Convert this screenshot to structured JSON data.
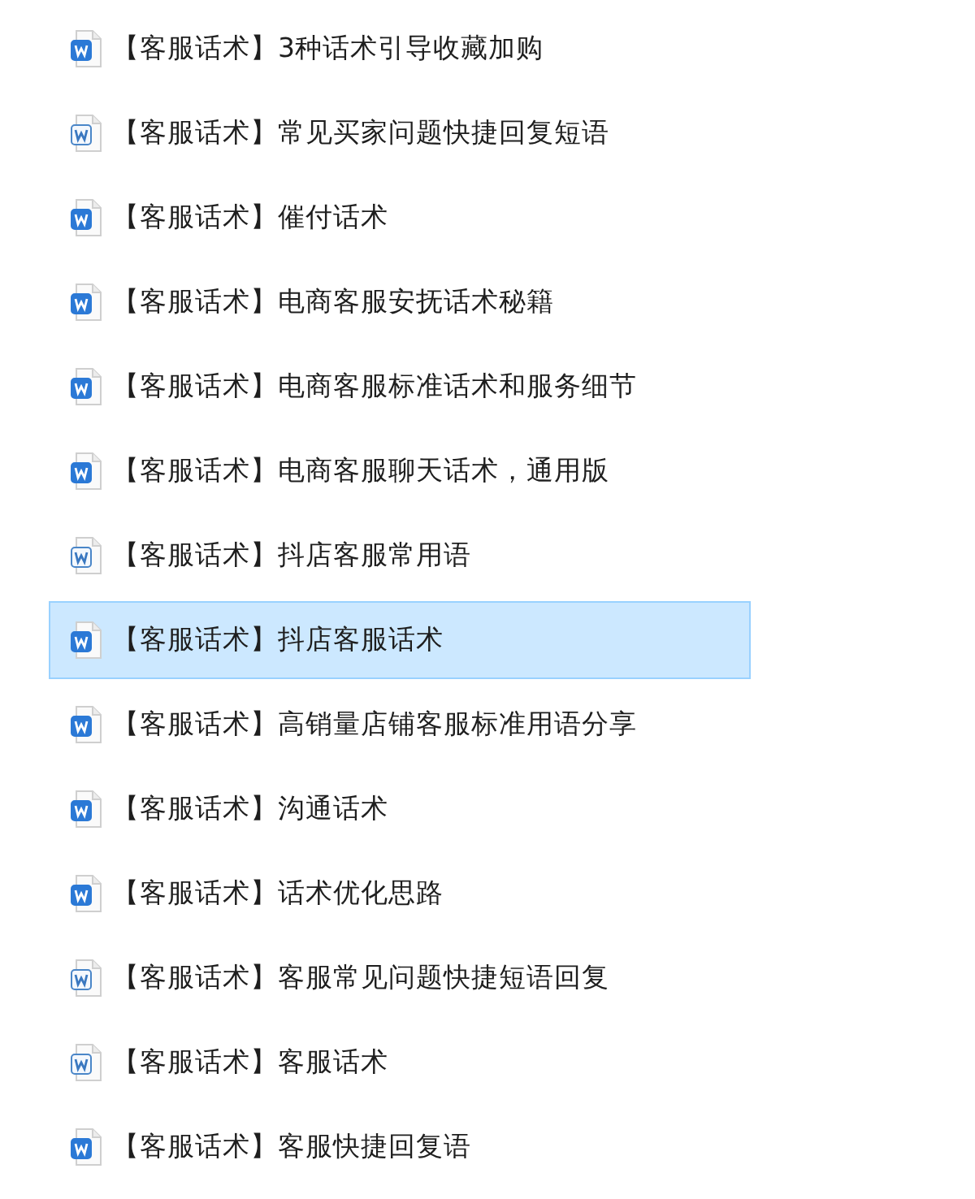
{
  "files": [
    {
      "name": "【客服话术】3种话术引导收藏加购",
      "kind": "docx",
      "selected": false
    },
    {
      "name": "【客服话术】常见买家问题快捷回复短语",
      "kind": "doc",
      "selected": false
    },
    {
      "name": "【客服话术】催付话术",
      "kind": "docx",
      "selected": false
    },
    {
      "name": "【客服话术】电商客服安抚话术秘籍",
      "kind": "docx",
      "selected": false
    },
    {
      "name": "【客服话术】电商客服标准话术和服务细节",
      "kind": "docx",
      "selected": false
    },
    {
      "name": "【客服话术】电商客服聊天话术，通用版",
      "kind": "docx",
      "selected": false
    },
    {
      "name": "【客服话术】抖店客服常用语",
      "kind": "doc",
      "selected": false
    },
    {
      "name": "【客服话术】抖店客服话术",
      "kind": "docx",
      "selected": true
    },
    {
      "name": "【客服话术】高销量店铺客服标准用语分享",
      "kind": "docx",
      "selected": false
    },
    {
      "name": "【客服话术】沟通话术",
      "kind": "docx",
      "selected": false
    },
    {
      "name": "【客服话术】话术优化思路",
      "kind": "docx",
      "selected": false
    },
    {
      "name": "【客服话术】客服常见问题快捷短语回复",
      "kind": "doc",
      "selected": false
    },
    {
      "name": "【客服话术】客服话术",
      "kind": "doc",
      "selected": false
    },
    {
      "name": "【客服话术】客服快捷回复语",
      "kind": "docx",
      "selected": false
    }
  ]
}
